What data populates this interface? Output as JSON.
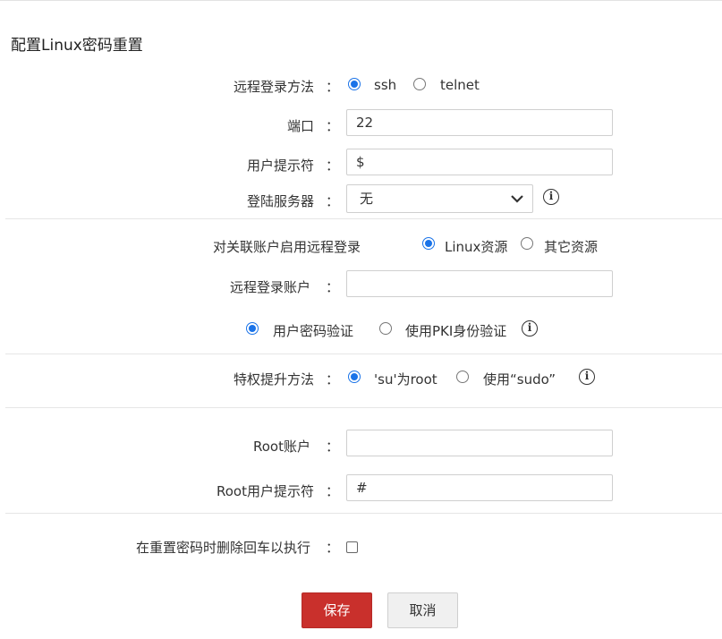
{
  "title": "配置Linux密码重置",
  "colon": "：",
  "login_method": {
    "label": "远程登录方法",
    "options": [
      {
        "label": "ssh",
        "checked": true
      },
      {
        "label": "telnet",
        "checked": false
      }
    ]
  },
  "port": {
    "label": "端口",
    "value": "22"
  },
  "user_prompt": {
    "label": "用户提示符",
    "value": "$"
  },
  "login_server": {
    "label": "登陆服务器",
    "value": "无"
  },
  "associated_login": {
    "label": "对关联账户启用远程登录",
    "options": [
      {
        "label": "Linux资源",
        "checked": true
      },
      {
        "label": "其它资源",
        "checked": false
      }
    ]
  },
  "remote_account": {
    "label": "远程登录账户",
    "value": ""
  },
  "auth_method": {
    "options": [
      {
        "label": "用户密码验证",
        "checked": true
      },
      {
        "label": "使用PKI身份验证",
        "checked": false
      }
    ]
  },
  "privilege": {
    "label": "特权提升方法",
    "options": [
      {
        "label": "'su'为root",
        "checked": true
      },
      {
        "label": "使用“sudo”",
        "checked": false
      }
    ]
  },
  "root_account": {
    "label": "Root账户",
    "value": ""
  },
  "root_prompt": {
    "label": "Root用户提示符",
    "value": "#"
  },
  "delete_cr": {
    "label": "在重置密码时删除回车以执行",
    "checked": false
  },
  "buttons": {
    "save": "保存",
    "cancel": "取消"
  },
  "colors": {
    "primary_red": "#c9302c",
    "radio_blue": "#1a73e8"
  },
  "icons": {
    "info": "info-circle-icon",
    "dropdown": "chevron-down-icon"
  }
}
